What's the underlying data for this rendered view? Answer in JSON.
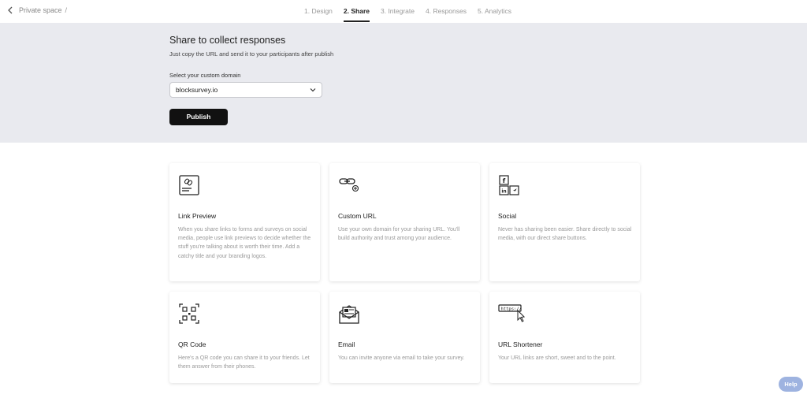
{
  "header": {
    "breadcrumb": "Private space",
    "breadcrumb_sep": "/",
    "steps": [
      {
        "label": "1. Design"
      },
      {
        "label": "2. Share"
      },
      {
        "label": "3. Integrate"
      },
      {
        "label": "4. Responses"
      },
      {
        "label": "5. Analytics"
      }
    ],
    "active_step": 1
  },
  "share": {
    "title": "Share to collect responses",
    "subtitle": "Just copy the URL and send it to your participants after publish",
    "domain_label": "Select your custom domain",
    "domain_value": "blocksurvey.io",
    "publish_label": "Publish"
  },
  "cards": [
    {
      "icon": "link-preview-icon",
      "title": "Link Preview",
      "desc": "When you share links to forms and surveys on social media, people use link previews to decide whether the stuff you're talking about is worth their time. Add a catchy title and your branding logos."
    },
    {
      "icon": "custom-url-icon",
      "title": "Custom URL",
      "desc": "Use your own domain for your sharing URL. You'll build authority and trust among your audience."
    },
    {
      "icon": "social-icon",
      "title": "Social",
      "desc": "Never has sharing been easier. Share directly to social media, with our direct share buttons."
    },
    {
      "icon": "qr-code-icon",
      "title": "QR Code",
      "desc": "Here's a QR code you can share it to your friends. Let them answer from their phones."
    },
    {
      "icon": "email-icon",
      "title": "Email",
      "desc": "You can invite anyone via email to take your survey."
    },
    {
      "icon": "url-shortener-icon",
      "title": "URL Shortener",
      "desc": "Your URL links are short, sweet and to the point."
    }
  ],
  "social_glyphs": {
    "facebook": "f",
    "linkedin": "in"
  },
  "url_shortener_text": "https://",
  "help_label": "Help",
  "colors": {
    "panel_bg": "#e9eaef",
    "publish_bg": "#111111",
    "help_bg": "#9eb3e0"
  }
}
